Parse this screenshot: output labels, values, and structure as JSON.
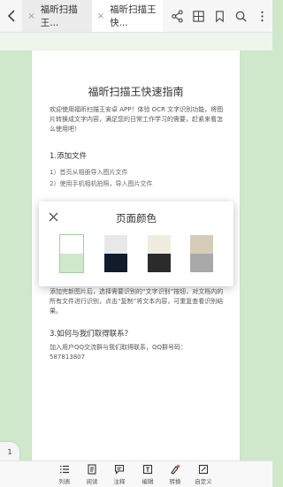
{
  "tabs": [
    {
      "label": "福昕扫描王...",
      "close": "×"
    },
    {
      "label": "福昕扫描王快...",
      "close": "×"
    }
  ],
  "document": {
    "title": "福昕扫描王快速指南",
    "intro": "欢迎使用福昕扫描王安卓 APP！体验 OCR 文字识别功能，将图片转换成文字内容，满足您的日常工作学习的需要，赶紧来看怎么使用吧！",
    "section1": "1.添加文件",
    "item1": "1）首页从相册导入图片文件",
    "item2": "2）使用手机相机拍照，导入图片文件",
    "para2": "添加完新图片后，选择需要识别的“文字识别”按钮，对文档内的所有文件进行识别，点击“复制”将文本内容，可重复查看识别结果。",
    "section3": "3.如何与我们取得联系？",
    "contact": "加入用户QQ交流群与我们取得联系，QQ群号码：587813807"
  },
  "picker": {
    "title": "页面颜色",
    "close_icon": "close-icon",
    "swatches": [
      {
        "name": "green-white",
        "top": "#ffffff",
        "bottom": "#cfe8cc",
        "selected": true
      },
      {
        "name": "gray-navy",
        "top": "#e8e8e8",
        "bottom": "#101c2a",
        "selected": false
      },
      {
        "name": "cream-dark",
        "top": "#f0ece0",
        "bottom": "#2b2b2b",
        "selected": false
      },
      {
        "name": "beige-gray",
        "top": "#d6cdb8",
        "bottom": "#a9a9a9",
        "selected": false
      }
    ]
  },
  "page_indicator": "1",
  "bottombar": [
    {
      "label": "列表",
      "icon": "list-icon"
    },
    {
      "label": "阅读",
      "icon": "read-icon"
    },
    {
      "label": "注释",
      "icon": "comment-icon"
    },
    {
      "label": "编辑",
      "icon": "edit-text-icon"
    },
    {
      "label": "转换",
      "icon": "convert-icon"
    },
    {
      "label": "自定义",
      "icon": "customize-icon"
    }
  ],
  "colors": {
    "accent": "#d9534f",
    "page_bg": "#cfe8cc"
  }
}
